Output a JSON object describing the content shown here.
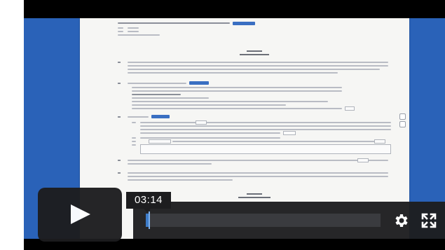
{
  "player": {
    "hover_time": "03:14",
    "progress": 0.012,
    "play_icon": "play-icon",
    "settings_icon": "gear-icon",
    "fullscreen_icon": "fullscreen-icon"
  },
  "colors": {
    "video_background": "#2a62b8",
    "document_highlight": "#3a6fc2",
    "controls": "#1d1d1f",
    "progress_fill": "#3d7cc9"
  }
}
